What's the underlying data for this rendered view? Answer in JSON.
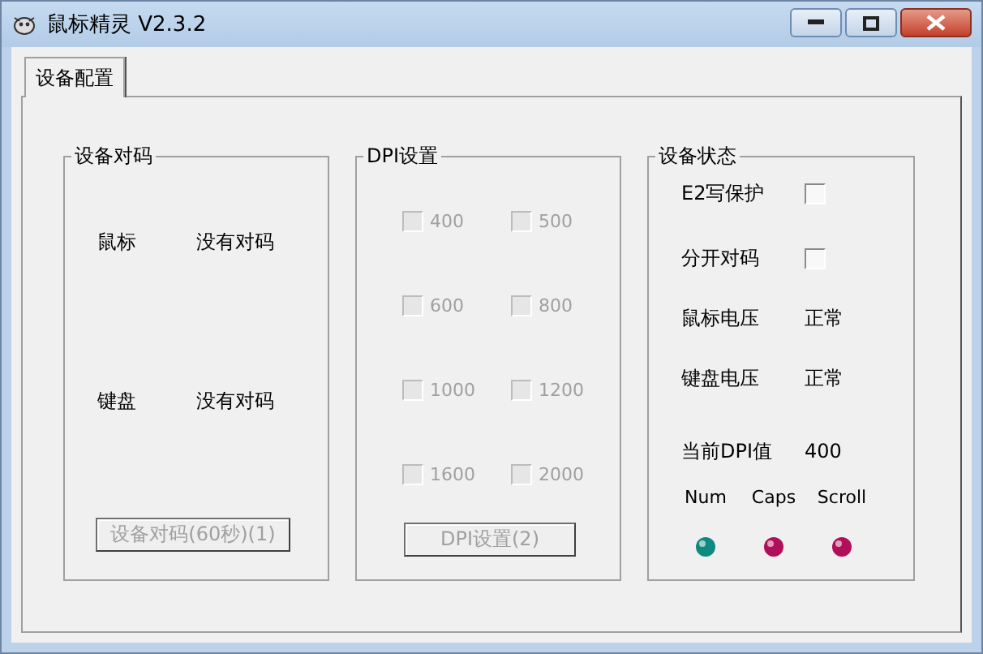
{
  "window": {
    "title": "鼠标精灵 V2.3.2"
  },
  "tabs": [
    {
      "label": "设备配置",
      "selected": true
    }
  ],
  "pairing": {
    "title": "设备对码",
    "rows": [
      {
        "device": "鼠标",
        "status": "没有对码"
      },
      {
        "device": "键盘",
        "status": "没有对码"
      }
    ],
    "button": {
      "label": "设备对码(60秒)(1)",
      "disabled": true
    }
  },
  "dpi": {
    "title": "DPI设置",
    "options": [
      {
        "label": "400",
        "checked": false,
        "disabled": true
      },
      {
        "label": "500",
        "checked": false,
        "disabled": true
      },
      {
        "label": "600",
        "checked": false,
        "disabled": true
      },
      {
        "label": "800",
        "checked": false,
        "disabled": true
      },
      {
        "label": "1000",
        "checked": false,
        "disabled": true
      },
      {
        "label": "1200",
        "checked": false,
        "disabled": true
      },
      {
        "label": "1600",
        "checked": false,
        "disabled": true
      },
      {
        "label": "2000",
        "checked": false,
        "disabled": true
      }
    ],
    "button": {
      "label": "DPI设置(2)",
      "disabled": true
    }
  },
  "status": {
    "title": "设备状态",
    "rows": [
      {
        "kind": "checkbox",
        "label": "E2写保护",
        "checked": false
      },
      {
        "kind": "checkbox",
        "label": "分开对码",
        "checked": false
      },
      {
        "kind": "text",
        "label": "鼠标电压",
        "value": "正常"
      },
      {
        "kind": "text",
        "label": "键盘电压",
        "value": "正常"
      },
      {
        "kind": "text",
        "label": "当前DPI值",
        "value": "400"
      }
    ],
    "leds": [
      {
        "label": "Num",
        "on": true
      },
      {
        "label": "Caps",
        "on": false
      },
      {
        "label": "Scroll",
        "on": false
      }
    ]
  }
}
